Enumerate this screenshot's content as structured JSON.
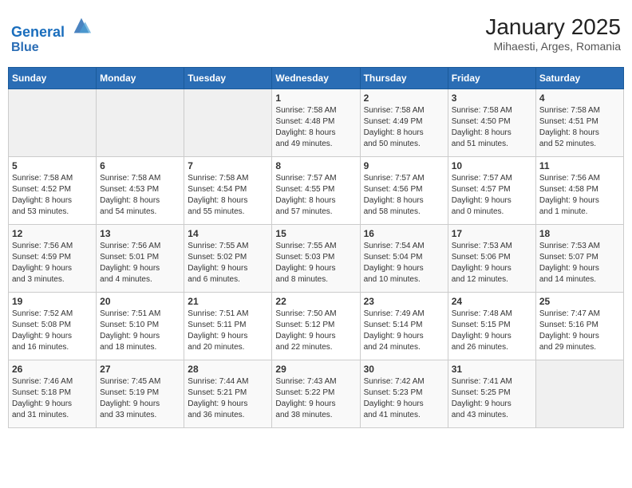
{
  "header": {
    "logo_line1": "General",
    "logo_line2": "Blue",
    "month": "January 2025",
    "location": "Mihaesti, Arges, Romania"
  },
  "weekdays": [
    "Sunday",
    "Monday",
    "Tuesday",
    "Wednesday",
    "Thursday",
    "Friday",
    "Saturday"
  ],
  "weeks": [
    [
      {
        "day": "",
        "info": ""
      },
      {
        "day": "",
        "info": ""
      },
      {
        "day": "",
        "info": ""
      },
      {
        "day": "1",
        "info": "Sunrise: 7:58 AM\nSunset: 4:48 PM\nDaylight: 8 hours\nand 49 minutes."
      },
      {
        "day": "2",
        "info": "Sunrise: 7:58 AM\nSunset: 4:49 PM\nDaylight: 8 hours\nand 50 minutes."
      },
      {
        "day": "3",
        "info": "Sunrise: 7:58 AM\nSunset: 4:50 PM\nDaylight: 8 hours\nand 51 minutes."
      },
      {
        "day": "4",
        "info": "Sunrise: 7:58 AM\nSunset: 4:51 PM\nDaylight: 8 hours\nand 52 minutes."
      }
    ],
    [
      {
        "day": "5",
        "info": "Sunrise: 7:58 AM\nSunset: 4:52 PM\nDaylight: 8 hours\nand 53 minutes."
      },
      {
        "day": "6",
        "info": "Sunrise: 7:58 AM\nSunset: 4:53 PM\nDaylight: 8 hours\nand 54 minutes."
      },
      {
        "day": "7",
        "info": "Sunrise: 7:58 AM\nSunset: 4:54 PM\nDaylight: 8 hours\nand 55 minutes."
      },
      {
        "day": "8",
        "info": "Sunrise: 7:57 AM\nSunset: 4:55 PM\nDaylight: 8 hours\nand 57 minutes."
      },
      {
        "day": "9",
        "info": "Sunrise: 7:57 AM\nSunset: 4:56 PM\nDaylight: 8 hours\nand 58 minutes."
      },
      {
        "day": "10",
        "info": "Sunrise: 7:57 AM\nSunset: 4:57 PM\nDaylight: 9 hours\nand 0 minutes."
      },
      {
        "day": "11",
        "info": "Sunrise: 7:56 AM\nSunset: 4:58 PM\nDaylight: 9 hours\nand 1 minute."
      }
    ],
    [
      {
        "day": "12",
        "info": "Sunrise: 7:56 AM\nSunset: 4:59 PM\nDaylight: 9 hours\nand 3 minutes."
      },
      {
        "day": "13",
        "info": "Sunrise: 7:56 AM\nSunset: 5:01 PM\nDaylight: 9 hours\nand 4 minutes."
      },
      {
        "day": "14",
        "info": "Sunrise: 7:55 AM\nSunset: 5:02 PM\nDaylight: 9 hours\nand 6 minutes."
      },
      {
        "day": "15",
        "info": "Sunrise: 7:55 AM\nSunset: 5:03 PM\nDaylight: 9 hours\nand 8 minutes."
      },
      {
        "day": "16",
        "info": "Sunrise: 7:54 AM\nSunset: 5:04 PM\nDaylight: 9 hours\nand 10 minutes."
      },
      {
        "day": "17",
        "info": "Sunrise: 7:53 AM\nSunset: 5:06 PM\nDaylight: 9 hours\nand 12 minutes."
      },
      {
        "day": "18",
        "info": "Sunrise: 7:53 AM\nSunset: 5:07 PM\nDaylight: 9 hours\nand 14 minutes."
      }
    ],
    [
      {
        "day": "19",
        "info": "Sunrise: 7:52 AM\nSunset: 5:08 PM\nDaylight: 9 hours\nand 16 minutes."
      },
      {
        "day": "20",
        "info": "Sunrise: 7:51 AM\nSunset: 5:10 PM\nDaylight: 9 hours\nand 18 minutes."
      },
      {
        "day": "21",
        "info": "Sunrise: 7:51 AM\nSunset: 5:11 PM\nDaylight: 9 hours\nand 20 minutes."
      },
      {
        "day": "22",
        "info": "Sunrise: 7:50 AM\nSunset: 5:12 PM\nDaylight: 9 hours\nand 22 minutes."
      },
      {
        "day": "23",
        "info": "Sunrise: 7:49 AM\nSunset: 5:14 PM\nDaylight: 9 hours\nand 24 minutes."
      },
      {
        "day": "24",
        "info": "Sunrise: 7:48 AM\nSunset: 5:15 PM\nDaylight: 9 hours\nand 26 minutes."
      },
      {
        "day": "25",
        "info": "Sunrise: 7:47 AM\nSunset: 5:16 PM\nDaylight: 9 hours\nand 29 minutes."
      }
    ],
    [
      {
        "day": "26",
        "info": "Sunrise: 7:46 AM\nSunset: 5:18 PM\nDaylight: 9 hours\nand 31 minutes."
      },
      {
        "day": "27",
        "info": "Sunrise: 7:45 AM\nSunset: 5:19 PM\nDaylight: 9 hours\nand 33 minutes."
      },
      {
        "day": "28",
        "info": "Sunrise: 7:44 AM\nSunset: 5:21 PM\nDaylight: 9 hours\nand 36 minutes."
      },
      {
        "day": "29",
        "info": "Sunrise: 7:43 AM\nSunset: 5:22 PM\nDaylight: 9 hours\nand 38 minutes."
      },
      {
        "day": "30",
        "info": "Sunrise: 7:42 AM\nSunset: 5:23 PM\nDaylight: 9 hours\nand 41 minutes."
      },
      {
        "day": "31",
        "info": "Sunrise: 7:41 AM\nSunset: 5:25 PM\nDaylight: 9 hours\nand 43 minutes."
      },
      {
        "day": "",
        "info": ""
      }
    ]
  ]
}
